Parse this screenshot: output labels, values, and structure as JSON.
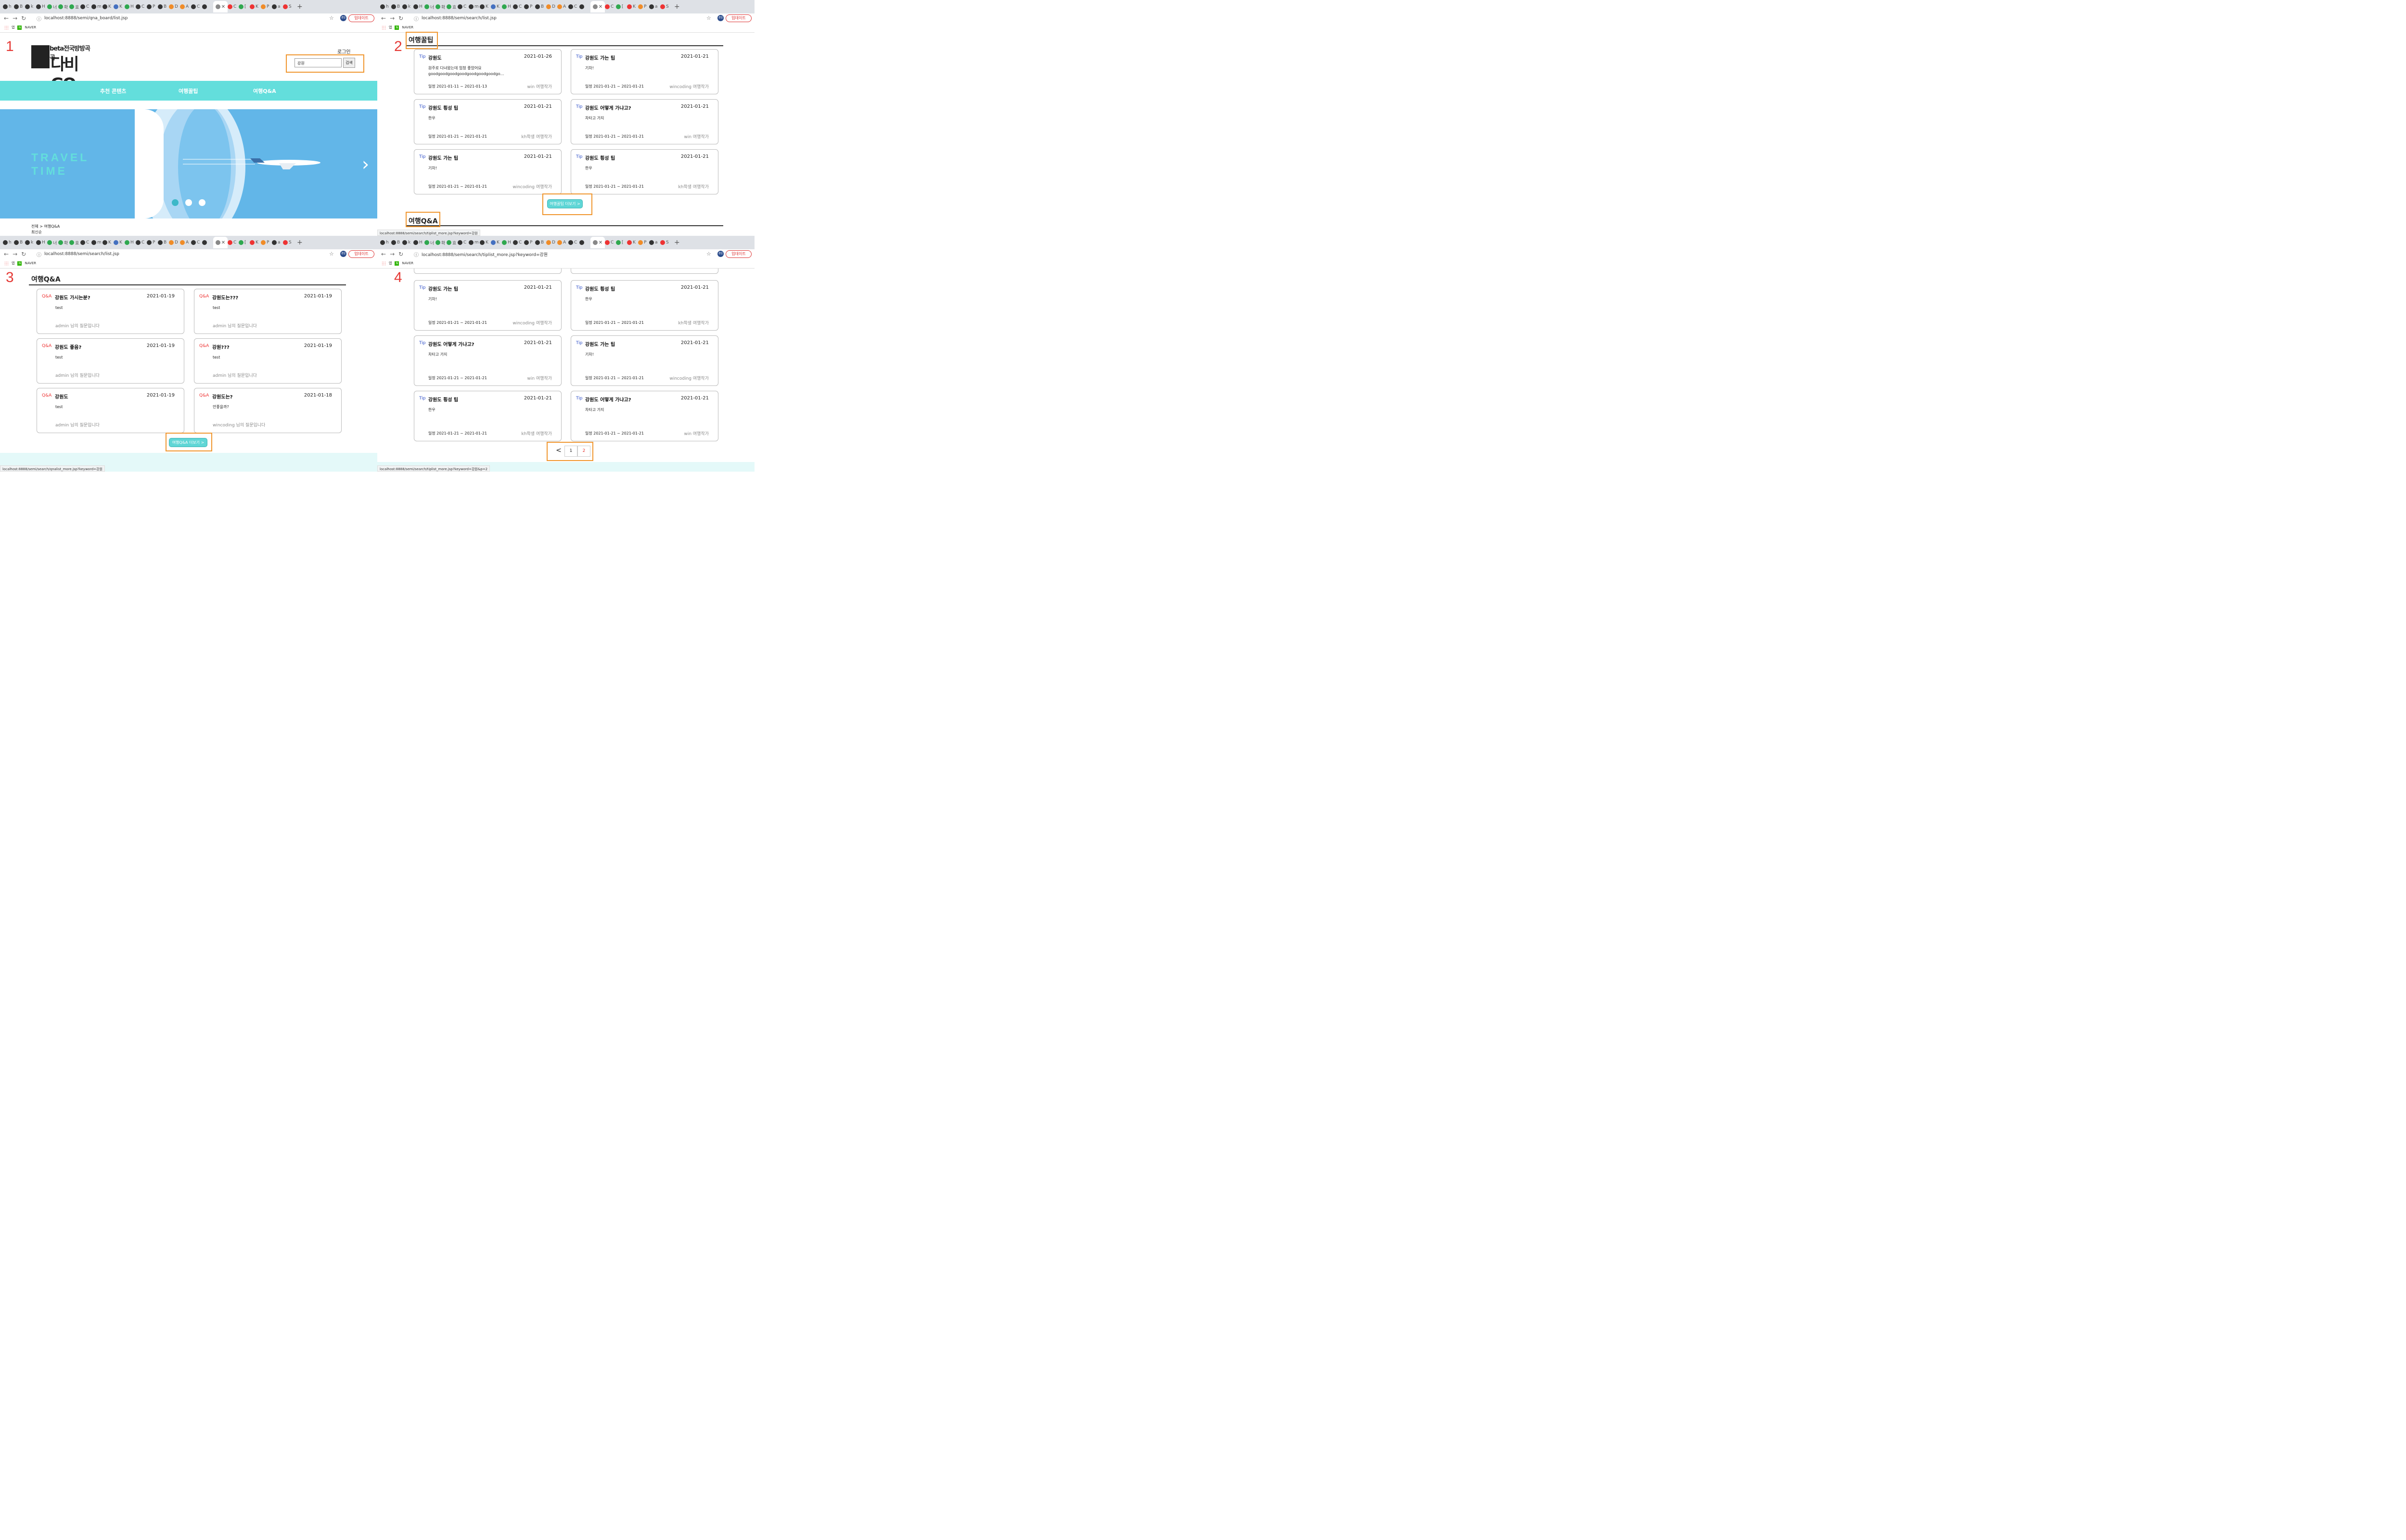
{
  "browser": {
    "tab_letters": [
      "h",
      "B",
      "k",
      "H",
      "너",
      "확",
      "효",
      "C",
      "m",
      "K",
      "K",
      "H",
      "C",
      "P",
      "B",
      "D",
      "A",
      "C",
      "",
      "C",
      "[",
      "K",
      "P",
      "a",
      "S"
    ],
    "update_label": "업데이트",
    "profile_label": "경일",
    "bookmark_apps": "앱",
    "bookmark_naver": "NAVER"
  },
  "panels": [
    {
      "number": "1",
      "url": "localhost:8888/semi/qna_board/list.jsp"
    },
    {
      "number": "2",
      "url": "localhost:8888/semi/search/list.jsp"
    },
    {
      "number": "3",
      "url": "localhost:8888/semi/search/list.jsp"
    },
    {
      "number": "4",
      "url": "localhost:8888/semi/search/tiplist_more.jsp?keyword=강원"
    }
  ],
  "home": {
    "logo_beta": "beta전국방방곡곡",
    "logo_main": "다비GO",
    "login": "로그인",
    "search_value": "강원",
    "search_button": "검색",
    "nav": [
      "추천 콘텐츠",
      "여행꿀팁",
      "여행Q&A"
    ],
    "banner_text_1": "TRAVEL",
    "banner_text_2": "TIME",
    "breadcrumb": "전체 > 여행Q&A",
    "sort": "최신순"
  },
  "tips_section": {
    "title": "여행꿀팁",
    "more_button": "여행꿀팁 더보기 >",
    "qa_title": "여행Q&A",
    "status_url": "localhost:8888/semi/search/tiplist_more.jsp?keyword=강원",
    "cards": [
      {
        "tag": "Tip",
        "title": "강원도",
        "date": "2021-01-26",
        "body": "원주로 다녀왔는데 엄청 좋았어요 goodgoodgoodgoodgoodgoodgoodgo…",
        "schedule": "일정 2021-01-11 ~ 2021-01-13",
        "author": "win 여행작가"
      },
      {
        "tag": "Tip",
        "title": "강원도 가는 팁",
        "date": "2021-01-21",
        "body": "기차!",
        "schedule": "일정 2021-01-21 ~ 2021-01-21",
        "author": "wincoding 여행작가"
      },
      {
        "tag": "Tip",
        "title": "강원도 횡성 팁",
        "date": "2021-01-21",
        "body": "한우",
        "schedule": "일정 2021-01-21 ~ 2021-01-21",
        "author": "kh학생 여행작가"
      },
      {
        "tag": "Tip",
        "title": "강원도 어떻게 가냐고?",
        "date": "2021-01-21",
        "body": "차타고 가지",
        "schedule": "일정 2021-01-21 ~ 2021-01-21",
        "author": "win 여행작가"
      },
      {
        "tag": "Tip",
        "title": "강원도 가는 팁",
        "date": "2021-01-21",
        "body": "기차!",
        "schedule": "일정 2021-01-21 ~ 2021-01-21",
        "author": "wincoding 여행작가"
      },
      {
        "tag": "Tip",
        "title": "강원도 횡성 팁",
        "date": "2021-01-21",
        "body": "한우",
        "schedule": "일정 2021-01-21 ~ 2021-01-21",
        "author": "kh학생 여행작가"
      }
    ]
  },
  "qa_section": {
    "title": "여행Q&A",
    "more_button": "여행Q&A 더보기 >",
    "status_url": "localhost:8888/semi/search/qnalist_more.jsp?keyword=강원",
    "cards": [
      {
        "tag": "Q&A",
        "title": "강원도 가시는분?",
        "date": "2021-01-19",
        "body": "test",
        "asked": "admin 님의 질문입니다"
      },
      {
        "tag": "Q&A",
        "title": "강원도는???",
        "date": "2021-01-19",
        "body": "test",
        "asked": "admin 님의 질문입니다"
      },
      {
        "tag": "Q&A",
        "title": "강원도 좋음?",
        "date": "2021-01-19",
        "body": "test",
        "asked": "admin 님의 질문입니다"
      },
      {
        "tag": "Q&A",
        "title": "강원???",
        "date": "2021-01-19",
        "body": "test",
        "asked": "admin 님의 질문입니다"
      },
      {
        "tag": "Q&A",
        "title": "강원도",
        "date": "2021-01-19",
        "body": "test",
        "asked": "admin 님의 질문입니다"
      },
      {
        "tag": "Q&A",
        "title": "강원도는?",
        "date": "2021-01-18",
        "body": "안좋을까?",
        "asked": "wincoding 님의 질문입니다"
      }
    ]
  },
  "more_page": {
    "status_url": "localhost:8888/semi/search/tiplist_more.jsp?keyword=강원&p=2",
    "pager": [
      "<",
      "1",
      "2"
    ],
    "current_page": "2",
    "cards": [
      {
        "tag": "Tip",
        "title": "강원도 가는 팁",
        "date": "2021-01-21",
        "body": "기차!",
        "schedule": "일정 2021-01-21 ~ 2021-01-21",
        "author": "wincoding 여행작가"
      },
      {
        "tag": "Tip",
        "title": "강원도 횡성 팁",
        "date": "2021-01-21",
        "body": "한우",
        "schedule": "일정 2021-01-21 ~ 2021-01-21",
        "author": "kh학생 여행작가"
      },
      {
        "tag": "Tip",
        "title": "강원도 어떻게 가냐고?",
        "date": "2021-01-21",
        "body": "차타고 가지",
        "schedule": "일정 2021-01-21 ~ 2021-01-21",
        "author": "win 여행작가"
      },
      {
        "tag": "Tip",
        "title": "강원도 가는 팁",
        "date": "2021-01-21",
        "body": "기차!",
        "schedule": "일정 2021-01-21 ~ 2021-01-21",
        "author": "wincoding 여행작가"
      },
      {
        "tag": "Tip",
        "title": "강원도 횡성 팁",
        "date": "2021-01-21",
        "body": "한우",
        "schedule": "일정 2021-01-21 ~ 2021-01-21",
        "author": "kh학생 여행작가"
      },
      {
        "tag": "Tip",
        "title": "강원도 어떻게 가냐고?",
        "date": "2021-01-21",
        "body": "차타고 가지",
        "schedule": "일정 2021-01-21 ~ 2021-01-21",
        "author": "win 여행작가"
      }
    ]
  },
  "colors": {
    "accent": "#63dedc",
    "highlight": "#f0962e",
    "tip_tag": "#3050c8",
    "qa_tag": "#e53935",
    "number": "#e53935"
  }
}
